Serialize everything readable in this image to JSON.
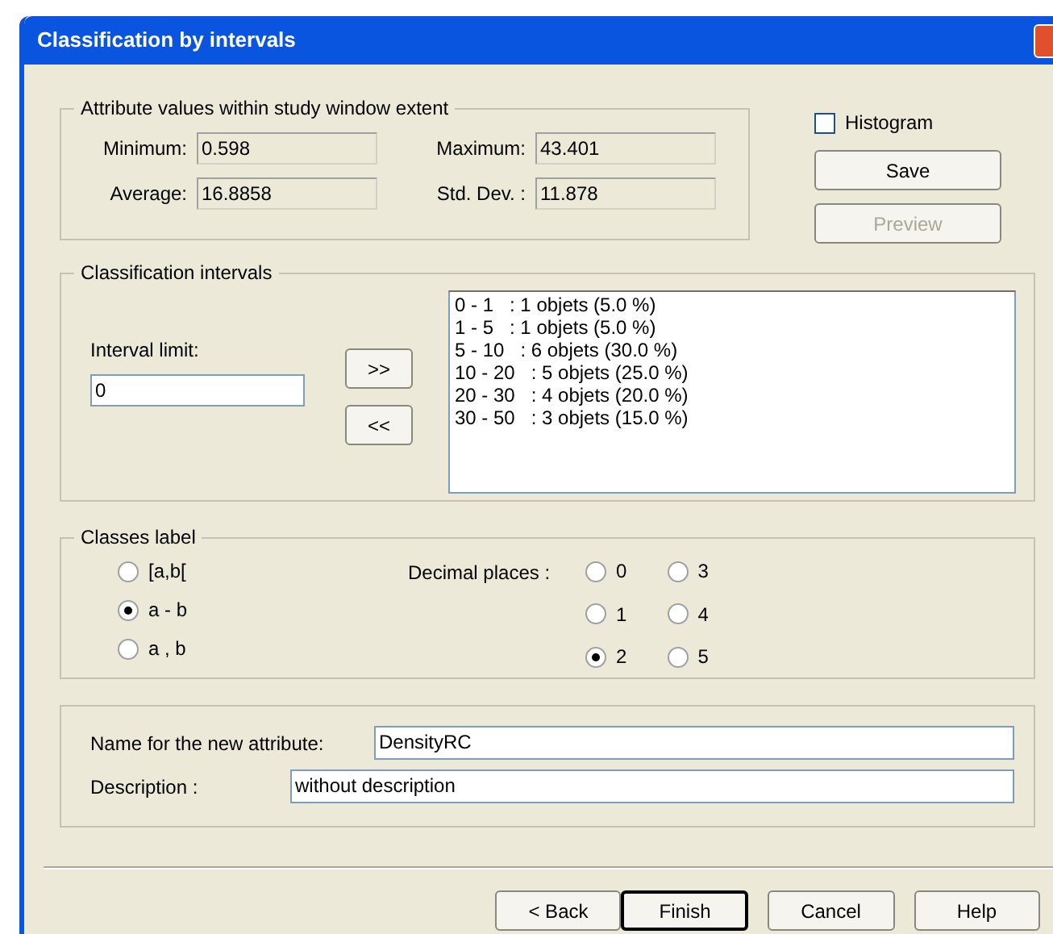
{
  "window": {
    "title": "Classification by intervals"
  },
  "attribute_values": {
    "title": "Attribute values within study window extent",
    "fields": [
      {
        "label": "Minimum:",
        "value": "0.598"
      },
      {
        "label": "Maximum:",
        "value": "43.401"
      },
      {
        "label": "Average:",
        "value": "16.8858"
      },
      {
        "label": "Std. Dev. :",
        "value": "11.878"
      }
    ]
  },
  "histogram": {
    "label": "Histogram",
    "checked": false
  },
  "side_buttons": [
    {
      "label": "Save",
      "disabled": false
    },
    {
      "label": "Preview",
      "disabled": true
    }
  ],
  "intervals": {
    "title": "Classification intervals",
    "limit_label": "Interval limit:",
    "limit_value": "0",
    "add_button": ">>",
    "remove_button": "<<",
    "items": [
      "0 - 1   : 1 objets (5.0 %)",
      "1 - 5   : 1 objets (5.0 %)",
      "5 - 10   : 6 objets (30.0 %)",
      "10 - 20   : 5 objets (25.0 %)",
      "20 - 30   : 4 objets (20.0 %)",
      "30 - 50   : 3 objets (15.0 %)"
    ]
  },
  "classes_label": {
    "title": "Classes label",
    "options": [
      {
        "label": "[a,b[",
        "selected": false
      },
      {
        "label": "a - b",
        "selected": true
      },
      {
        "label": "a , b",
        "selected": false
      }
    ],
    "decimal_label": "Decimal places :",
    "decimal_options": [
      {
        "label": "0",
        "selected": false
      },
      {
        "label": "1",
        "selected": false
      },
      {
        "label": "2",
        "selected": true
      },
      {
        "label": "3",
        "selected": false
      },
      {
        "label": "4",
        "selected": false
      },
      {
        "label": "5",
        "selected": false
      }
    ]
  },
  "attribute": {
    "name_label": "Name for the new attribute:",
    "name_value": "DensityRC",
    "description_label": "Description :",
    "description_value": "without description"
  },
  "footer_buttons": [
    {
      "label": "< Back",
      "default": false
    },
    {
      "label": "Finish",
      "default": true
    },
    {
      "label": "Cancel",
      "default": false
    },
    {
      "label": "Help",
      "default": false
    }
  ]
}
